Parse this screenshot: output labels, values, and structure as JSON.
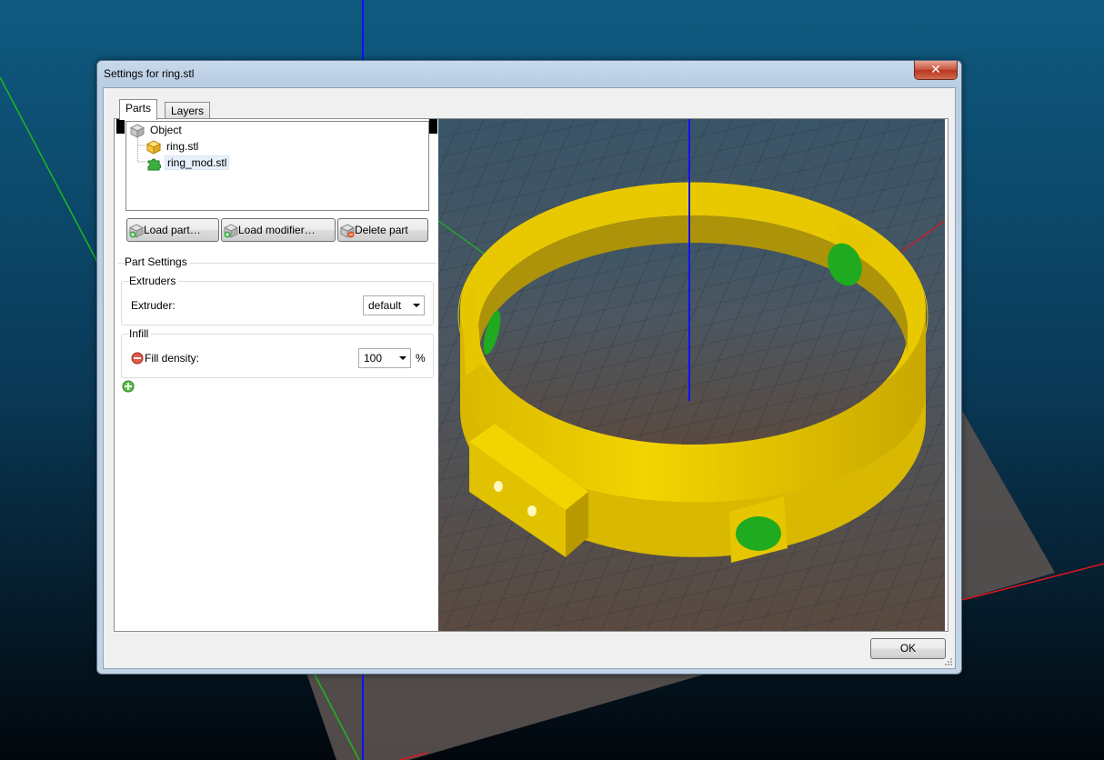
{
  "window": {
    "title": "Settings for ring.stl",
    "close_glyph": "✕"
  },
  "tabs": [
    {
      "label": "Parts",
      "active": true
    },
    {
      "label": "Layers",
      "active": false
    }
  ],
  "tree": {
    "items": [
      {
        "label": "Object",
        "icon": "cube-icon",
        "level": 0
      },
      {
        "label": "ring.stl",
        "icon": "part-cube-icon",
        "level": 1
      },
      {
        "label": "ring_mod.stl",
        "icon": "puzzle-icon",
        "level": 1,
        "selected": true
      }
    ]
  },
  "buttons": {
    "load_part": "Load part…",
    "load_modifier": "Load modifier…",
    "delete_part": "Delete part",
    "ok": "OK"
  },
  "part_settings": {
    "title": "Part Settings",
    "extruders": {
      "title": "Extruders",
      "label": "Extruder:",
      "value": "default"
    },
    "infill": {
      "title": "Infill",
      "label": "Fill density:",
      "value": "100",
      "unit": "%"
    }
  },
  "colors": {
    "ring": "#e8c800",
    "modifier": "#1faa1f",
    "axis_x": "#e0161a",
    "axis_y": "#1db81d",
    "axis_z": "#1010ff"
  }
}
